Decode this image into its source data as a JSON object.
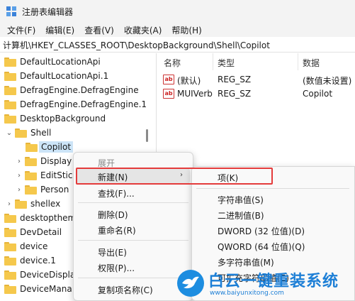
{
  "window": {
    "title": "注册表编辑器"
  },
  "menubar": {
    "items": [
      "文件(F)",
      "编辑(E)",
      "查看(V)",
      "收藏夹(A)",
      "帮助(H)"
    ]
  },
  "address": "计算机\\HKEY_CLASSES_ROOT\\DesktopBackground\\Shell\\Copilot",
  "tree": {
    "items": [
      {
        "label": "DefaultLocationApi"
      },
      {
        "label": "DefaultLocationApi.1"
      },
      {
        "label": "DefragEngine.DefragEngine"
      },
      {
        "label": "DefragEngine.DefragEngine.1"
      },
      {
        "label": "DesktopBackground"
      },
      {
        "label": "Shell",
        "chevron": "⌄"
      },
      {
        "label": "Copilot"
      },
      {
        "label": "Display",
        "chevron": "›"
      },
      {
        "label": "EditStic",
        "chevron": "›"
      },
      {
        "label": "Person",
        "chevron": "›"
      },
      {
        "label": "shellex",
        "chevron": "›"
      },
      {
        "label": "desktopthem"
      },
      {
        "label": "DevDetail"
      },
      {
        "label": "device"
      },
      {
        "label": "device.1"
      },
      {
        "label": "DeviceDispla"
      },
      {
        "label": "DeviceMana"
      }
    ]
  },
  "list": {
    "headers": {
      "name": "名称",
      "type": "类型",
      "data": "数据"
    },
    "rows": [
      {
        "icon": "ab",
        "name": "(默认)",
        "type": "REG_SZ",
        "data": "(数值未设置)"
      },
      {
        "icon": "ab",
        "name": "MUIVerb",
        "type": "REG_SZ",
        "data": "Copilot"
      }
    ]
  },
  "context_menu": {
    "expand": "展开",
    "new": "新建(N)",
    "find": "查找(F)...",
    "delete": "删除(D)",
    "rename": "重命名(R)",
    "export": "导出(E)",
    "permissions": "权限(P)...",
    "copy_key_name": "复制项名称(C)",
    "submenu_arrow": "›"
  },
  "submenu": {
    "key": "项(K)",
    "string": "字符串值(S)",
    "binary": "二进制值(B)",
    "dword": "DWORD (32 位值)(D)",
    "qword": "QWORD (64 位值)(Q)",
    "multi_string": "多字符串值(M)",
    "expandable_string": "可扩充字符串值(E)"
  },
  "watermark": {
    "title": "白云一键重装系统",
    "url": "www.baiyunxitong.com"
  },
  "colors": {
    "selection": "#cce4f7",
    "highlight_box": "#e43b3b",
    "brand": "#1d7fd6"
  }
}
